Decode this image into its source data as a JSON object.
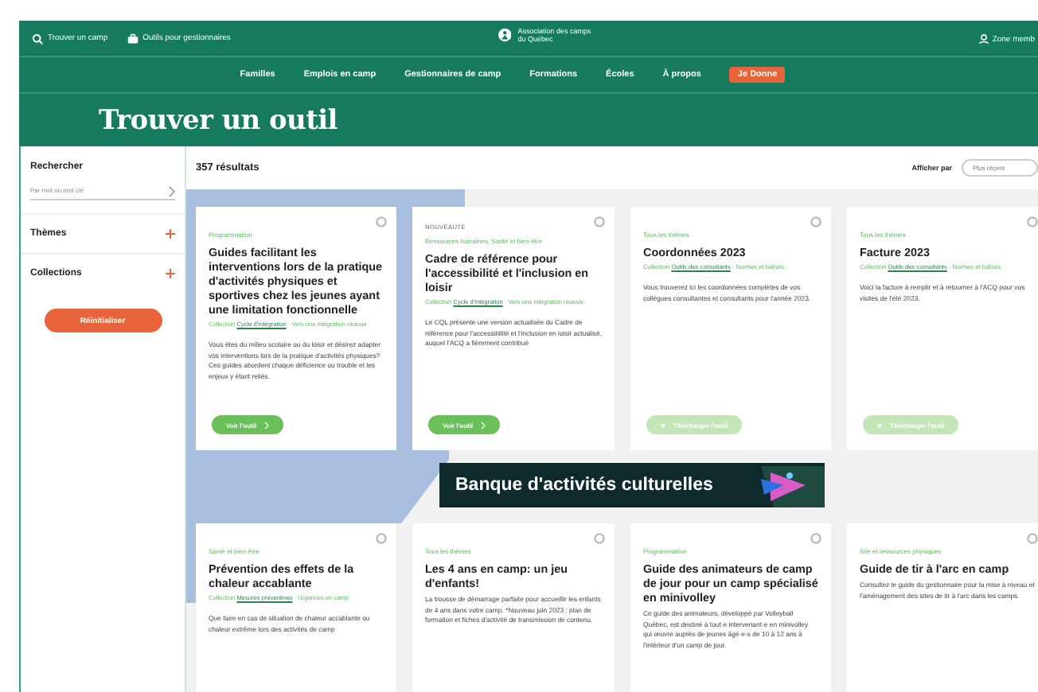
{
  "top_bar": {
    "links": [
      {
        "label": "Trouver un camp",
        "kind": "search"
      },
      {
        "label": "Outils pour gestionnaires",
        "kind": "tools"
      }
    ],
    "logo": "Association des camps du Québec",
    "account": "Zone memb"
  },
  "nav": [
    {
      "label": "Familles",
      "kind": "link"
    },
    {
      "label": "Emplois en camp",
      "kind": "link"
    },
    {
      "label": "Gestionnaires de camp",
      "kind": "link"
    },
    {
      "label": "Formations",
      "kind": "link"
    },
    {
      "label": "Écoles",
      "kind": "link"
    },
    {
      "label": "À propos",
      "kind": "link"
    },
    {
      "label": "Je Donne",
      "kind": "donate"
    }
  ],
  "page_title": "Trouver un outil",
  "sidebar": {
    "search_label": "Rechercher",
    "search": {
      "placeholder": "Par mot ou mot clé"
    },
    "filters": [
      {
        "label": "Thèmes",
        "expanded": false
      },
      {
        "label": "Collections",
        "expanded": false
      }
    ],
    "reset": "Réinitialiser"
  },
  "results": {
    "count": "357 résultats",
    "sort_label": "Afficher par",
    "sort_value": "Plus récent"
  },
  "cards": [
    {
      "category": "Programmation",
      "title": "Guides facilitant les interventions lors de la pratique d'activités physiques et sportives chez les jeunes ayant une limitation fonctionnelle",
      "collection": "Collection",
      "collection_link": "Cycle d'intégration",
      "collection_rest": "· Vers une intégration réussie",
      "description": "Vous êtes du milieu scolaire ou du loisir et désirez adapter vos interventions lors de la pratique d'activités physiques? Ces guides abordent chaque déficience ou trouble et les enjeux y étant reliés.",
      "button": {
        "label": "Voir l'outil",
        "kind": "view",
        "disabled": false
      }
    },
    {
      "badge": "NOUVEAUTÉ",
      "category": "Ressources humaines, Santé et bien-être",
      "title": "Cadre de référence pour l'accessibilité et l'inclusion en loisir",
      "collection": "Collection",
      "collection_link": "Cycle d'intégration",
      "collection_rest": "· Vers une intégration réussie",
      "description": "Le CQL présente une version actualisée du Cadre de référence pour l'accessibilité et l'inclusion en loisir actualisé, auquel l'ACQ a fièrement contribué",
      "button": {
        "label": "Voir l'outil",
        "kind": "view",
        "disabled": false
      }
    },
    {
      "category": "Tous les thèmes",
      "title": "Coordonnées 2023",
      "collection": "Collection",
      "collection_link": "Outils des consultants",
      "collection_rest": "· Normes et balises",
      "description": "Vous trouverez ici les coordonnées complètes de vos collègues consultantes et consultants pour l'année 2023.",
      "button": {
        "label": "Télécharger l'outil",
        "kind": "download",
        "disabled": true
      }
    },
    {
      "category": "Tous les thèmes",
      "title": "Facture 2023",
      "collection": "Collection",
      "collection_link": "Outils des consultants",
      "collection_rest": "· Normes et balises",
      "description": "Voici la facture à remplir et à retourner à l'ACQ pour vos visites de l'été 2023.",
      "button": {
        "label": "Télécharger l'outil",
        "kind": "download",
        "disabled": true
      }
    }
  ],
  "banner": "Banque d'activités culturelles",
  "cards_2": [
    {
      "category": "Santé et bien-être",
      "title": "Prévention des effets de la chaleur accablante",
      "collection": "Collection",
      "collection_link": "Mesures préventives",
      "collection_rest": "· Urgences en camp",
      "description": "Que faire en cas de situation de chaleur accablante ou chaleur extrême lors des activités de camp"
    },
    {
      "category": "Tous les thèmes",
      "title": "Les 4 ans en camp: un jeu d'enfants!",
      "description": "La trousse de démarrage parfaite pour accueillir les enfants de 4 ans dans votre camp. *Nouveau juin 2023 : plan de formation et fiches d'activité de transmission de contenu."
    },
    {
      "category": "Programmation",
      "title": "Guide des animateurs de camp de jour pour un camp spécialisé en minivolley",
      "description": "Ce guide des animateurs, développé par Volleyball Québec, est destiné à tout·e intervenant·e en minivolley qui œuvre auprès de jeunes âgé·e·s de 10 à 12 ans à l'intérieur d'un camp de jour."
    },
    {
      "category": "Site et ressources physiques",
      "title": "Guide de tir à l'arc en camp",
      "description": "Consultez le guide du gestionnaire pour la mise à niveau et l'aménagement des sites de tir à l'arc dans les camps"
    }
  ]
}
